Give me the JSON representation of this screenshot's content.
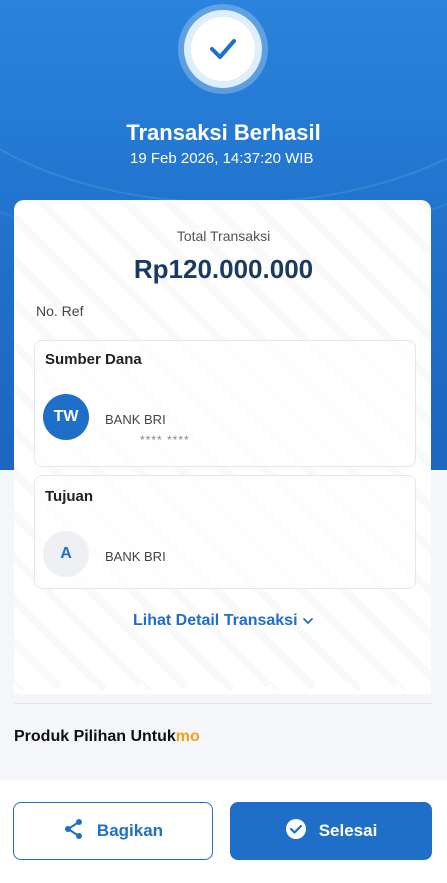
{
  "header": {
    "status_title": "Transaksi Berhasil",
    "datetime": "19 Feb 2026, 14:37:20 WIB"
  },
  "receipt": {
    "total_label": "Total Transaksi",
    "amount": "Rp120.000.000",
    "ref_label": "No. Ref",
    "source": {
      "title": "Sumber Dana",
      "avatar": "TW",
      "bank": "BANK BRI",
      "account": "**** ****"
    },
    "destination": {
      "title": "Tujuan",
      "avatar": "A",
      "bank": "BANK BRI"
    },
    "detail_link": "Lihat Detail Transaksi",
    "watermark_text": "BRI"
  },
  "products": {
    "label": "Produk Pilihan Untuk",
    "label_suffix": "mo"
  },
  "actions": {
    "share_label": "Bagikan",
    "done_label": "Selesai"
  },
  "colors": {
    "brand_blue": "#1f6fc8",
    "amount_navy": "#1b3a63",
    "accent_orange": "#f0a21b"
  },
  "icons": {
    "status": "check-icon",
    "detail": "chevron-down-icon",
    "share": "share-icon",
    "done": "check-circle-icon"
  }
}
